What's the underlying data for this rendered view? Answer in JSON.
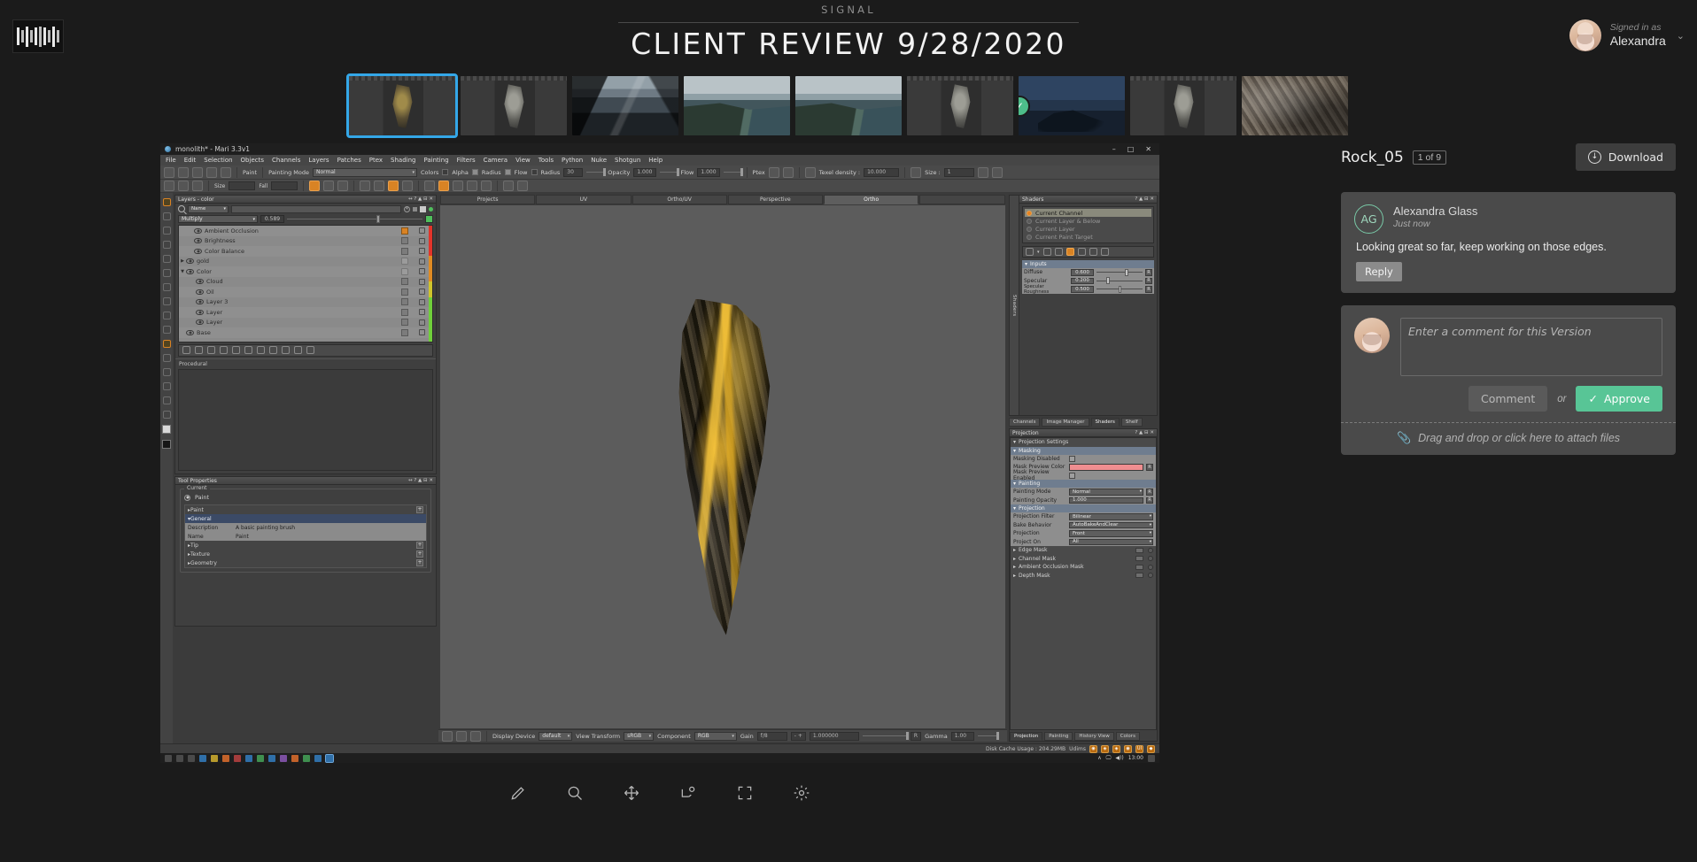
{
  "header": {
    "brand": "SIGNAL",
    "title": "CLIENT REVIEW 9/28/2020",
    "signed_in_label": "Signed in as",
    "user_name": "Alexandra",
    "caret": "⌄"
  },
  "thumbnails": [
    {
      "name": "thumb-1",
      "art": "t-ui",
      "selected": true,
      "approved": false
    },
    {
      "name": "thumb-2",
      "art": "t-ui grey",
      "selected": false,
      "approved": false
    },
    {
      "name": "thumb-3",
      "art": "t-mount",
      "selected": false,
      "approved": false
    },
    {
      "name": "thumb-4",
      "art": "t-coast",
      "selected": false,
      "approved": false
    },
    {
      "name": "thumb-5",
      "art": "t-coast",
      "selected": false,
      "approved": false
    },
    {
      "name": "thumb-6",
      "art": "t-ui grey",
      "selected": false,
      "approved": false
    },
    {
      "name": "thumb-7",
      "art": "t-night",
      "selected": false,
      "approved": true
    },
    {
      "name": "thumb-8",
      "art": "t-ui grey",
      "selected": false,
      "approved": false
    },
    {
      "name": "thumb-9",
      "art": "t-rock",
      "selected": false,
      "approved": false
    }
  ],
  "sidebar": {
    "asset_name": "Rock_05",
    "asset_count": "1 of 9",
    "download_label": "Download",
    "download_icon": "download-arrow-icon",
    "comment": {
      "avatar_initials": "AG",
      "author": "Alexandra Glass",
      "timestamp": "Just now",
      "text": "Looking great so far, keep working on those edges.",
      "reply_label": "Reply"
    },
    "new_comment": {
      "placeholder": "Enter a comment for this Version",
      "value": "",
      "comment_label": "Comment",
      "or_label": "or",
      "approve_label": "Approve",
      "approve_check": "✓",
      "attach_text": "Drag and drop or click here to attach files",
      "attach_icon": "paperclip-icon"
    }
  },
  "bottom_toolbar": [
    {
      "name": "annotate-tool",
      "icon": "pencil-icon"
    },
    {
      "name": "zoom-tool",
      "icon": "magnifier-icon"
    },
    {
      "name": "pan-tool",
      "icon": "move-icon"
    },
    {
      "name": "compare-tool",
      "icon": "compare-icon"
    },
    {
      "name": "fullscreen-tool",
      "icon": "fullscreen-icon"
    },
    {
      "name": "settings-tool",
      "icon": "gear-icon"
    }
  ],
  "mari": {
    "window_title": "monolith* - Mari 3.3v1",
    "window_buttons": [
      "–",
      "□",
      "✕"
    ],
    "menus": [
      "File",
      "Edit",
      "Selection",
      "Objects",
      "Channels",
      "Layers",
      "Patches",
      "Ptex",
      "Shading",
      "Painting",
      "Filters",
      "Camera",
      "View",
      "Tools",
      "Python",
      "Nuke",
      "Shotgun",
      "Help"
    ],
    "toolbar": {
      "paint_label": "Paint",
      "painting_mode_label": "Painting Mode",
      "painting_mode_value": "Normal",
      "colors_label": "Colors",
      "alpha_label": "Alpha",
      "radius_toggle_label": "Radius",
      "flow_toggle_label": "Flow",
      "radius_label": "Radius",
      "radius_value": "30",
      "opacity_label": "Opacity",
      "opacity_value": "1.000",
      "flow_label": "Flow",
      "flow_value": "1.000",
      "ptex_label": "Ptex",
      "texel_density_label": "Texel density :",
      "texel_density_value": "10.000",
      "size_label": "Size :",
      "size_value": "1"
    },
    "layers_panel": {
      "title": "Layers - color",
      "search_filter": "Name",
      "search_value": "",
      "blend_mode": "Multiply",
      "opacity": "0.589",
      "layers": [
        {
          "name": "Ambient Occlusion",
          "indent": 1,
          "eye": true,
          "tri": "",
          "thumb": "orange"
        },
        {
          "name": "Brightness",
          "indent": 1,
          "eye": true,
          "tri": "",
          "thumb": "adj"
        },
        {
          "name": "Color Balance",
          "indent": 1,
          "eye": true,
          "tri": "",
          "thumb": "adj"
        },
        {
          "name": "gold",
          "indent": 0,
          "eye": true,
          "tri": "▶",
          "thumb": "folder"
        },
        {
          "name": "Color",
          "indent": 0,
          "eye": true,
          "tri": "▼",
          "thumb": "folder"
        },
        {
          "name": "Cloud",
          "indent": 2,
          "eye": true,
          "tri": "",
          "thumb": "proc"
        },
        {
          "name": "Oil",
          "indent": 2,
          "eye": true,
          "tri": "",
          "thumb": "proc"
        },
        {
          "name": "Layer 3",
          "indent": 2,
          "eye": true,
          "tri": "",
          "thumb": "paint"
        },
        {
          "name": "Layer",
          "indent": 2,
          "eye": true,
          "tri": "",
          "thumb": "paint"
        },
        {
          "name": "Layer",
          "indent": 2,
          "eye": true,
          "tri": "",
          "thumb": "paint"
        },
        {
          "name": "Base",
          "indent": 0,
          "eye": true,
          "tri": "",
          "thumb": "paint"
        }
      ],
      "procedural_label": "Procedural"
    },
    "tool_properties": {
      "title": "Tool Properties",
      "current_legend": "Current",
      "current_tool": "Paint",
      "paint_group": "Paint",
      "general_group": "General",
      "description_key": "Description",
      "description_value": "A basic painting brush",
      "name_key": "Name",
      "name_value": "Paint",
      "sections": [
        "Tip",
        "Texture",
        "Geometry"
      ]
    },
    "viewport_tabs": [
      "Projects",
      "UV",
      "Ortho/UV",
      "Perspective",
      "Ortho"
    ],
    "viewport_active_tab": "Ortho",
    "color_bar": {
      "display_device_label": "Display Device",
      "display_device_value": "default",
      "view_transform_label": "View Transform",
      "view_transform_value": "sRGB",
      "component_label": "Component",
      "component_value": "RGB",
      "gain_label": "Gain",
      "gain_value": "f/8",
      "gain_number": "1.000000",
      "reset_label": "R",
      "gamma_label": "Gamma",
      "gamma_value": "1.00"
    },
    "shaders_panel": {
      "title": "Shaders",
      "side_tab": "Shaders",
      "channels": [
        "Current Channel",
        "Current Layer & Below",
        "Current Layer",
        "Current Paint Target"
      ],
      "selected_channel": "Current Channel",
      "inputs_header": "Inputs",
      "inputs": [
        {
          "label": "Diffuse",
          "value": "0.600",
          "pos": 62
        },
        {
          "label": "Specular",
          "value": "0.200",
          "pos": 22
        },
        {
          "label": "Specular Roughness",
          "value": "0.500",
          "pos": 48
        }
      ]
    },
    "panel_tabs": [
      "Channels",
      "Image Manager",
      "Shaders",
      "Shelf"
    ],
    "panel_active_tab": "Shaders",
    "projection_panel": {
      "title": "Projection",
      "settings_header": "Projection Settings",
      "masking_header": "Masking",
      "masking_disabled_label": "Masking Disabled",
      "mask_preview_color_label": "Mask Preview Color",
      "mask_preview_color": "#ef8e90",
      "mask_preview_enabled_label": "Mask Preview Enabled",
      "painting_header": "Painting",
      "painting_mode_label": "Painting Mode",
      "painting_mode_value": "Normal",
      "painting_opacity_label": "Painting Opacity",
      "painting_opacity_value": "1.000",
      "projection_header": "Projection",
      "projection_filter_label": "Projection Filter",
      "projection_filter_value": "Bilinear",
      "bake_behavior_label": "Bake Behavior",
      "bake_behavior_value": "AutoBakeAndClear",
      "projection_label": "Projection",
      "projection_value": "Front",
      "project_on_label": "Project On",
      "project_on_value": "All",
      "masks": [
        "Edge Mask",
        "Channel Mask",
        "Ambient Occlusion Mask",
        "Depth Mask"
      ],
      "reset_label": "R"
    },
    "bottom_tabs": [
      "Projection",
      "Painting",
      "History View",
      "Colors"
    ],
    "bottom_active_tab": "Projection",
    "status": {
      "disk_cache": "Disk Cache Usage : 204.29MB",
      "udims": "Udims",
      "badges": [
        "◉",
        "◈",
        "◈",
        "◉",
        "UI",
        "◆"
      ]
    },
    "taskbar": {
      "time": "13:00",
      "tray": [
        "∧",
        "🖵",
        "◀))"
      ]
    }
  }
}
